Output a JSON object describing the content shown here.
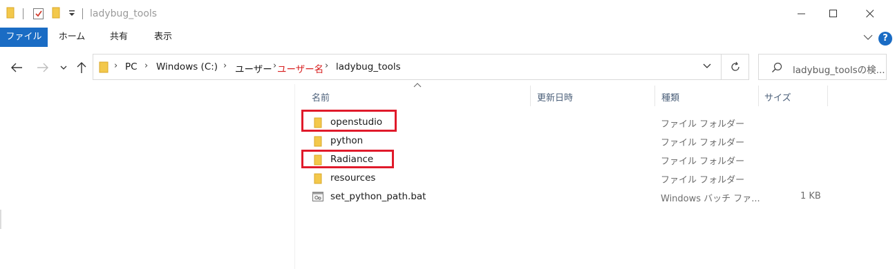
{
  "window": {
    "title": "ladybug_tools"
  },
  "ribbon": {
    "tabs": [
      {
        "label": "ファイル"
      },
      {
        "label": "ホーム"
      },
      {
        "label": "共有"
      },
      {
        "label": "表示"
      }
    ],
    "help_label": "?"
  },
  "address": {
    "crumbs": [
      "PC",
      "Windows (C:)",
      "ユーザー",
      "ユーザー名",
      "ladybug_tools"
    ],
    "highlight_crumb_color": "#d71e1e"
  },
  "search": {
    "placeholder": "ladybug_toolsの検..."
  },
  "columns": {
    "name": "名前",
    "date": "更新日時",
    "type": "種類",
    "size": "サイズ"
  },
  "files": [
    {
      "name": "openstudio",
      "type": "ファイル フォルダー",
      "size": "",
      "icon": "folder-icon",
      "highlighted": true
    },
    {
      "name": "python",
      "type": "ファイル フォルダー",
      "size": "",
      "icon": "folder-icon",
      "highlighted": false
    },
    {
      "name": "Radiance",
      "type": "ファイル フォルダー",
      "size": "",
      "icon": "folder-icon",
      "highlighted": true
    },
    {
      "name": "resources",
      "type": "ファイル フォルダー",
      "size": "",
      "icon": "folder-icon",
      "highlighted": false
    },
    {
      "name": "set_python_path.bat",
      "type": "Windows バッチ ファ...",
      "size": "1 KB",
      "icon": "batch-file-icon",
      "highlighted": false
    }
  ],
  "colors": {
    "accent": "#1a6cc4",
    "highlight_box": "#e01a2a",
    "folder": "#f3c84b"
  }
}
